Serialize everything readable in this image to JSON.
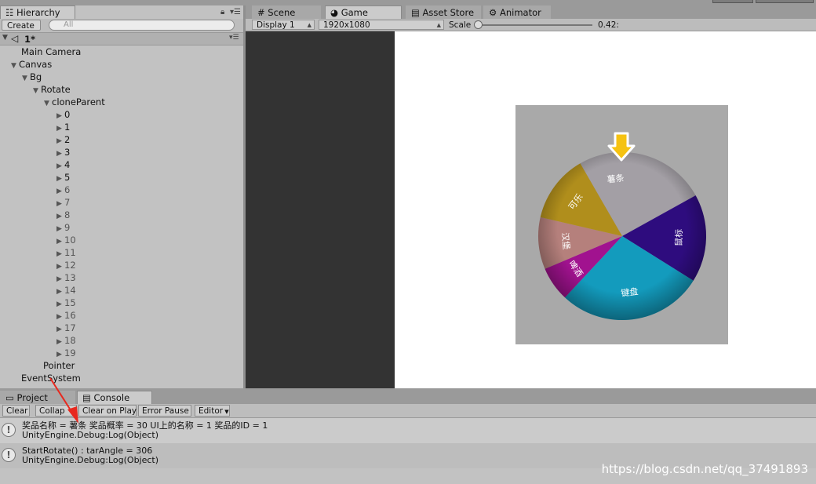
{
  "hierarchy": {
    "tab_label": "Hierarchy",
    "create_label": "Create",
    "search_placeholder": "All",
    "scene_name": "1*",
    "items": {
      "main_camera": "Main Camera",
      "canvas": "Canvas",
      "bg": "Bg",
      "rotate": "Rotate",
      "clone_parent": "cloneParent",
      "children": [
        "0",
        "1",
        "2",
        "3",
        "4",
        "5",
        "6",
        "7",
        "8",
        "9",
        "10",
        "11",
        "12",
        "13",
        "14",
        "15",
        "16",
        "17",
        "18",
        "19"
      ],
      "active_children": 6,
      "pointer": "Pointer",
      "event_system": "EventSystem"
    }
  },
  "tabs": {
    "scene": "Scene",
    "game": "Game",
    "asset_store": "Asset Store",
    "animator": "Animator"
  },
  "game_toolbar": {
    "display": "Display 1",
    "resolution": "1920x1080",
    "scale_label": "Scale",
    "scale_value": "0.42:",
    "scale_fraction": 0.0
  },
  "wheel": {
    "pointer_color": "#f5c211",
    "segments": [
      {
        "label": "薯条",
        "color": "#a39fa5",
        "start": -74,
        "end": 61
      },
      {
        "label": "鼠标",
        "color": "#2e0c7e",
        "start": 61,
        "end": 122
      },
      {
        "label": "键盘",
        "color": "#139bbd",
        "start": 122,
        "end": 223
      },
      {
        "label": "啤酒",
        "color": "#a1128f",
        "start": 223,
        "end": 247
      },
      {
        "label": "汉堡",
        "color": "#b5807c",
        "start": 247,
        "end": 283
      },
      {
        "label": "可乐",
        "color": "#b08e1c",
        "start": 283,
        "end": 330
      }
    ]
  },
  "bottom": {
    "project_tab": "Project",
    "console_tab": "Console",
    "buttons": {
      "clear": "Clear",
      "collapse": "Collap",
      "clear_on_play": "Clear on Play",
      "error_pause": "Error Pause",
      "editor": "Editor"
    },
    "logs": [
      {
        "line1": "奖品名称 = 薯条  奖品概率 = 30  UI上的名称 = 1  奖品的ID = 1",
        "line2": "UnityEngine.Debug:Log(Object)"
      },
      {
        "line1": "StartRotate() : tarAngle = 306",
        "line2": "UnityEngine.Debug:Log(Object)"
      }
    ]
  },
  "watermark": "https://blog.csdn.net/qq_37491893"
}
